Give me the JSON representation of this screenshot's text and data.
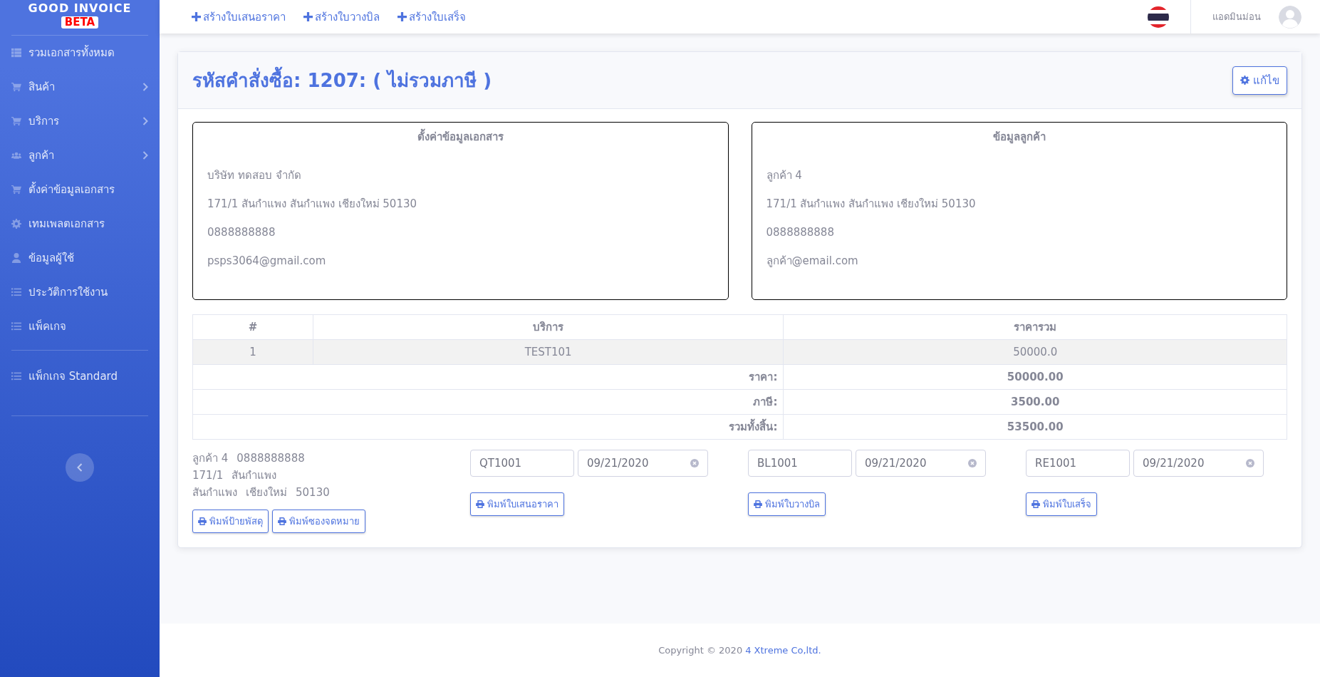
{
  "sidebar": {
    "brand": "GOOD INVOICE",
    "badge": "BETA",
    "sections": [
      {
        "items": [
          {
            "label": "รวมเอกสารทั้งหมด",
            "expandable": false
          },
          {
            "label": "สินค้า",
            "expandable": true
          },
          {
            "label": "บริการ",
            "expandable": true
          },
          {
            "label": "ลูกค้า",
            "expandable": true
          },
          {
            "label": "ตั้งค่าข้อมูลเอกสาร",
            "expandable": false
          },
          {
            "label": "เทมเพลตเอกสาร",
            "expandable": false
          },
          {
            "label": "ข้อมูลผู้ใช้",
            "expandable": false
          },
          {
            "label": "ประวัติการใช้งาน",
            "expandable": false
          },
          {
            "label": "แพ็คเกจ",
            "expandable": false
          }
        ]
      },
      {
        "items": [
          {
            "label": "แพ็กเกจ Standard",
            "expandable": false
          }
        ]
      }
    ]
  },
  "topbar": {
    "links": [
      "สร้างใบเสนอราคา",
      "สร้างใบวางบิล",
      "สร้างใบเสร็จ"
    ],
    "user": "แอดมินม่อน"
  },
  "card": {
    "title": "รหัสคำสั่งซื้อ: 1207: ( ไม่รวมภาษี )",
    "edit_button": "แก้ไข",
    "info_boxes": [
      {
        "title": "ตั้งค่าข้อมูลเอกสาร",
        "lines": [
          "บริษัท ทดสอบ จำกัด",
          "171/1 สันกำแพง สันกำแพง เชียงใหม่ 50130",
          "0888888888",
          "psps3064@gmail.com"
        ]
      },
      {
        "title": "ข้อมูลลูกค้า",
        "lines": [
          "ลูกค้า 4",
          "171/1 สันกำแพง สันกำแพง เชียงใหม่ 50130",
          "0888888888",
          "ลูกค้า@email.com"
        ]
      }
    ],
    "table": {
      "columns": [
        "#",
        "บริการ",
        "ราคารวม"
      ],
      "rows": [
        [
          "1",
          "TEST101",
          "50000.0"
        ]
      ],
      "totals": [
        {
          "label": "ราคา:",
          "value": "50000.00"
        },
        {
          "label": "ภาษี:",
          "value": "3500.00"
        },
        {
          "label": "รวมทั้งสิ้น:",
          "value": "53500.00"
        }
      ]
    },
    "address": [
      [
        "ลูกค้า 4",
        "0888888888"
      ],
      [
        "171/1",
        "สันกำแพง"
      ],
      [
        "สันกำแพง",
        "เชียงใหม่",
        "50130"
      ]
    ],
    "address_buttons": [
      "พิมพ์ป้ายพัสดุ",
      "พิมพ์ซองจดหมาย"
    ],
    "documents": [
      {
        "number": "QT1001",
        "date": "09/21/2020",
        "button": "พิมพ์ใบเสนอราคา"
      },
      {
        "number": "BL1001",
        "date": "09/21/2020",
        "button": "พิมพ์ใบวางบิล"
      },
      {
        "number": "RE1001",
        "date": "09/21/2020",
        "button": "พิมพ์ใบเสร็จ"
      }
    ]
  },
  "footer": {
    "text": "Copyright © 2020",
    "link": "4 Xtreme Co,ltd."
  }
}
